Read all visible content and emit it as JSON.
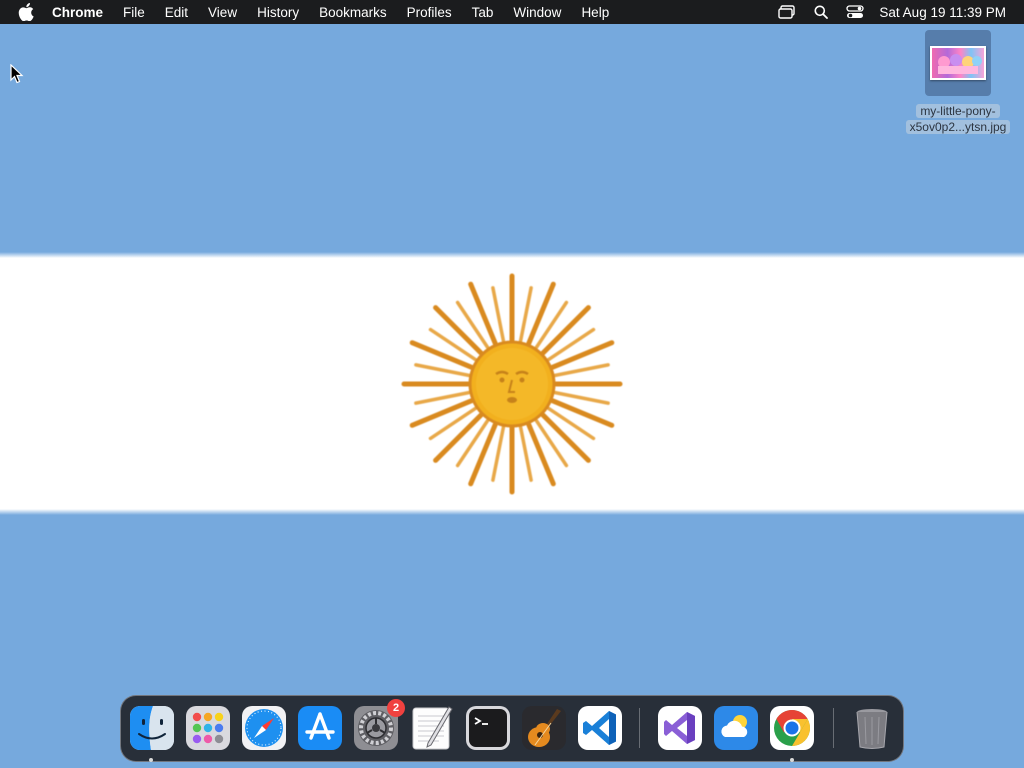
{
  "menubar": {
    "app_name": "Chrome",
    "items": [
      "File",
      "Edit",
      "View",
      "History",
      "Bookmarks",
      "Profiles",
      "Tab",
      "Window",
      "Help"
    ],
    "clock": "Sat Aug 19  11:39 PM"
  },
  "desktop": {
    "wallpaper": "Argentina flag",
    "colors": {
      "celeste": "#76a9dd",
      "white": "#ffffff",
      "sun": "#f2b01e",
      "sun_rays": "#d98a1f"
    },
    "file": {
      "name_line1": "my-little-pony-",
      "name_line2": "x5ov0p2...ytsn.jpg"
    }
  },
  "dock": {
    "apps": [
      {
        "name": "Finder",
        "icon": "finder-icon",
        "running": true
      },
      {
        "name": "Launchpad",
        "icon": "launchpad-icon",
        "running": false
      },
      {
        "name": "Safari",
        "icon": "safari-icon",
        "running": false
      },
      {
        "name": "App Store",
        "icon": "app-store-icon",
        "running": false
      },
      {
        "name": "System Settings",
        "icon": "system-settings-icon",
        "running": false,
        "badge": "2"
      },
      {
        "name": "TextEdit",
        "icon": "textedit-icon",
        "running": false
      },
      {
        "name": "Terminal",
        "icon": "terminal-icon",
        "running": false
      },
      {
        "name": "GarageBand",
        "icon": "garageband-icon",
        "running": false
      },
      {
        "name": "Visual Studio Code",
        "icon": "vscode-icon",
        "running": false
      },
      {
        "name": "Visual Studio",
        "icon": "visual-studio-icon",
        "running": false
      },
      {
        "name": "Weather",
        "icon": "weather-icon",
        "running": false
      },
      {
        "name": "Google Chrome",
        "icon": "chrome-icon",
        "running": true
      },
      {
        "name": "Trash",
        "icon": "trash-icon",
        "running": false
      }
    ]
  }
}
